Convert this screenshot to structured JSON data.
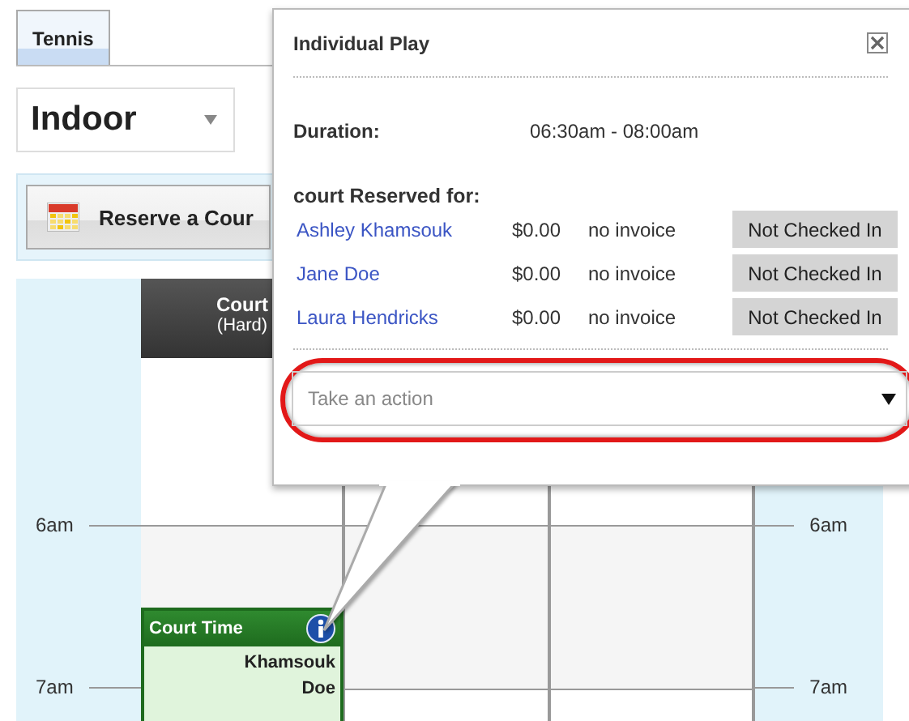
{
  "sport_tabs": [
    {
      "label": "Tennis",
      "selected": true
    }
  ],
  "location_dropdown": {
    "value": "Indoor"
  },
  "reserve_button": {
    "label": "Reserve a Cour"
  },
  "calendar": {
    "columns": [
      {
        "title": "Court",
        "subtitle": "(Hard)"
      },
      {},
      {}
    ],
    "time_labels_left": [
      "6am",
      "7am"
    ],
    "time_labels_right": [
      "6am",
      "7am"
    ],
    "event": {
      "title": "Court Time",
      "names": [
        "Khamsouk",
        "Doe"
      ]
    }
  },
  "popup": {
    "title": "Individual Play",
    "duration_label": "Duration:",
    "duration": "06:30am - 08:00am",
    "players_heading": "court Reserved for:",
    "players": [
      {
        "name": "Ashley Khamsouk",
        "amount": "$0.00",
        "invoice": "no invoice",
        "status": "Not Checked In"
      },
      {
        "name": "Jane Doe",
        "amount": "$0.00",
        "invoice": "no invoice",
        "status": "Not Checked In"
      },
      {
        "name": "Laura Hendricks",
        "amount": "$0.00",
        "invoice": "no invoice",
        "status": "Not Checked In"
      }
    ],
    "action_select": {
      "placeholder": "Take an action",
      "highlighted": true
    }
  }
}
